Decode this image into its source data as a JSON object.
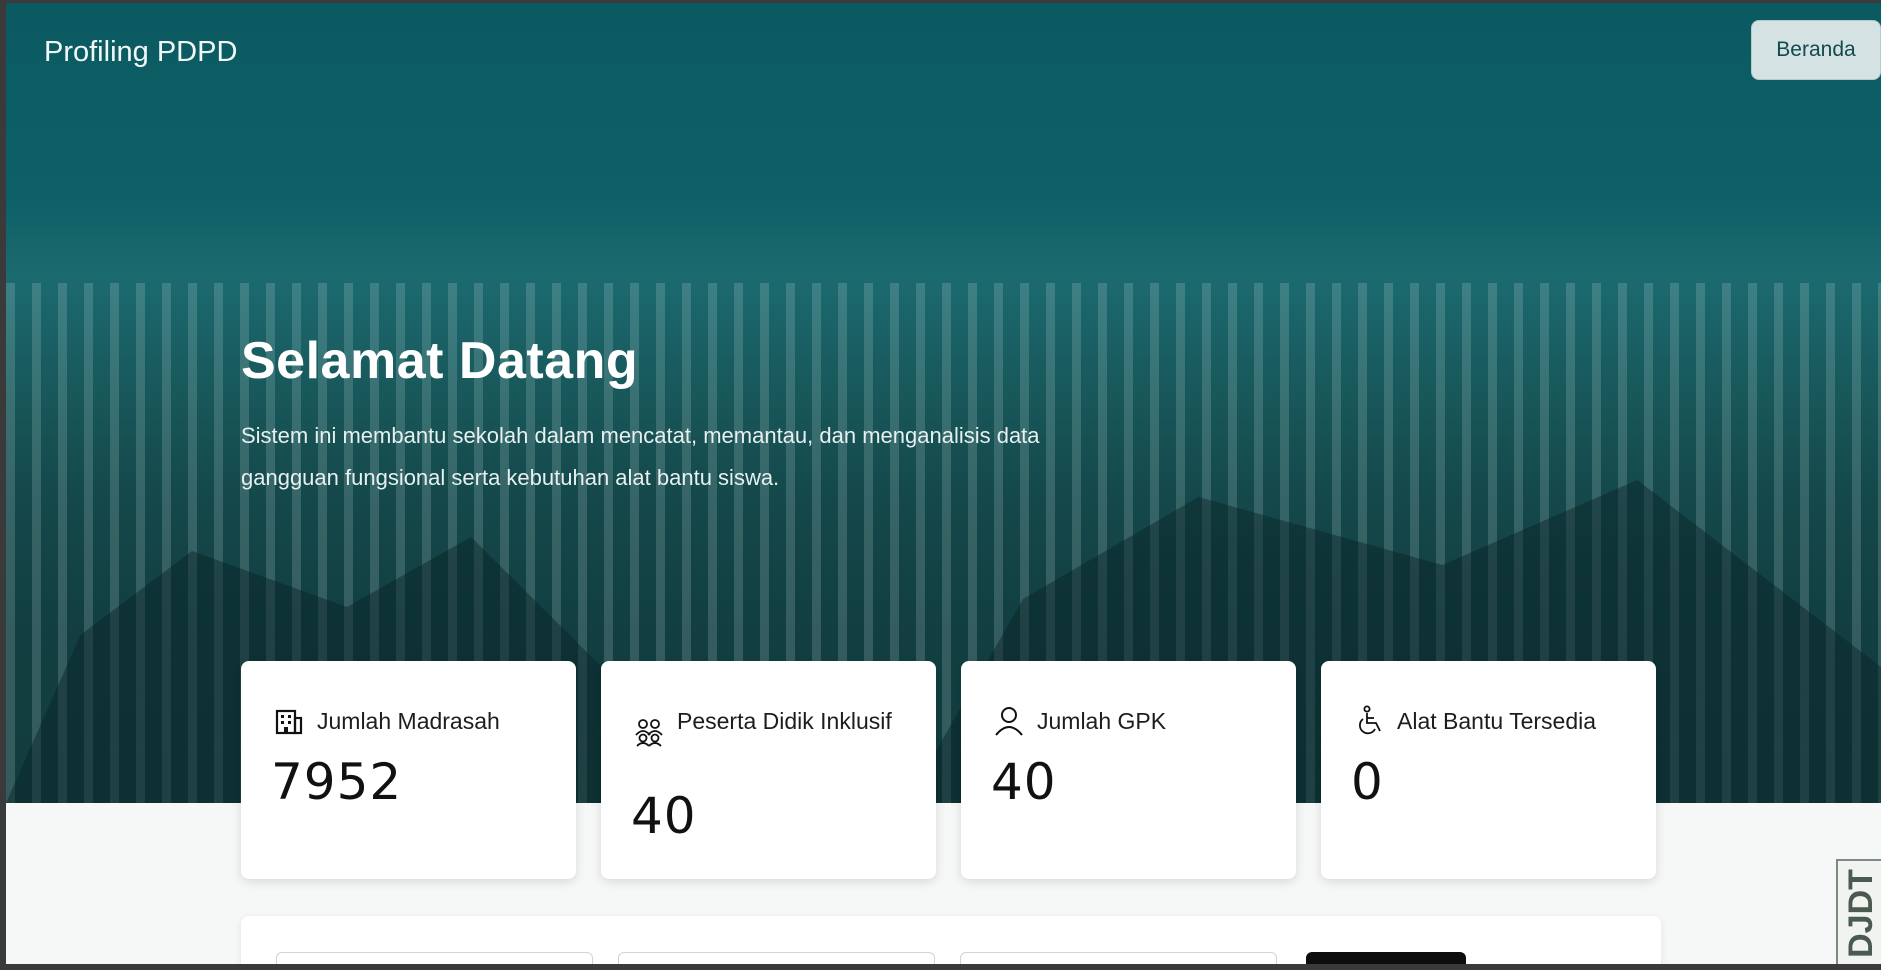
{
  "header": {
    "brand": "Profiling PDPD",
    "nav_home": "Beranda"
  },
  "hero": {
    "title": "Selamat Datang",
    "description": "Sistem ini membantu sekolah dalam mencatat, memantau, dan menganalisis data gangguan fungsional serta kebutuhan alat bantu siswa."
  },
  "stats": [
    {
      "label": "Jumlah Madrasah",
      "value": "7952",
      "icon": "building-icon"
    },
    {
      "label": "Peserta Didik Inklusif",
      "value": "40",
      "icon": "users-icon"
    },
    {
      "label": "Jumlah GPK",
      "value": "40",
      "icon": "user-icon"
    },
    {
      "label": "Alat Bantu Tersedia",
      "value": "0",
      "icon": "wheelchair-icon"
    }
  ],
  "badge": {
    "text": "DJDT"
  },
  "colors": {
    "hero_teal": "#0b5a62",
    "card_bg": "#ffffff",
    "page_bg": "#f6f7f7",
    "button_bg": "#d4e2e3"
  }
}
